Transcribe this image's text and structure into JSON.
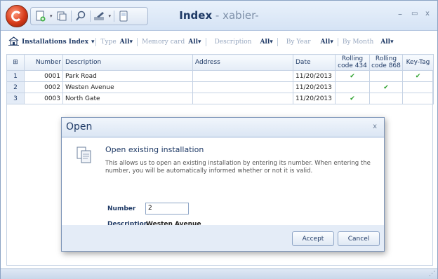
{
  "window": {
    "title": "Index",
    "title_sep": " - ",
    "subtitle": "xabier-",
    "minimize": "–",
    "maximize": "▭",
    "close": "x"
  },
  "filters": {
    "index_title": "Installations Index",
    "index_arrow": "▾",
    "items": [
      {
        "label": "Type",
        "value": "All▾"
      },
      {
        "label": "Memory card",
        "value": "All▾"
      },
      {
        "label": "Description",
        "value": "All▾"
      },
      {
        "label": "By Year",
        "value": "All▾"
      },
      {
        "label": "By Month",
        "value": "All▾"
      }
    ]
  },
  "grid": {
    "corner_icon": "⊞",
    "columns": [
      "Number",
      "Description",
      "Address",
      "Date",
      "Rolling code 434",
      "Rolling code 868",
      "Key-Tag"
    ],
    "rows": [
      {
        "rn": "1",
        "num": "0001",
        "desc": "Park Road",
        "addr": "",
        "date": "11/20/2013",
        "rc434": "✔",
        "rc868": "",
        "key": "✔"
      },
      {
        "rn": "2",
        "num": "0002",
        "desc": "Westen Avenue",
        "addr": "",
        "date": "11/20/2013",
        "rc434": "",
        "rc868": "✔",
        "key": ""
      },
      {
        "rn": "3",
        "num": "0003",
        "desc": "North Gate",
        "addr": "",
        "date": "11/20/2013",
        "rc434": "✔",
        "rc868": "",
        "key": ""
      }
    ],
    "check_color": "#2aa02a"
  },
  "dialog": {
    "title": "Open",
    "close": "x",
    "heading": "Open existing installation",
    "description": "This allows us to open an existing installation by entering its number. When entering the number, you will be automatically informed whether or not it is valid.",
    "number_label": "Number",
    "number_value": "2",
    "description_label": "Description",
    "description_value": "Westen Avenue",
    "accept": "Accept",
    "cancel": "Cancel"
  },
  "statusbar": {
    "grip": "⋰"
  },
  "colors": {
    "accent": "#1f3a66",
    "frame": "#d5e3f5"
  }
}
